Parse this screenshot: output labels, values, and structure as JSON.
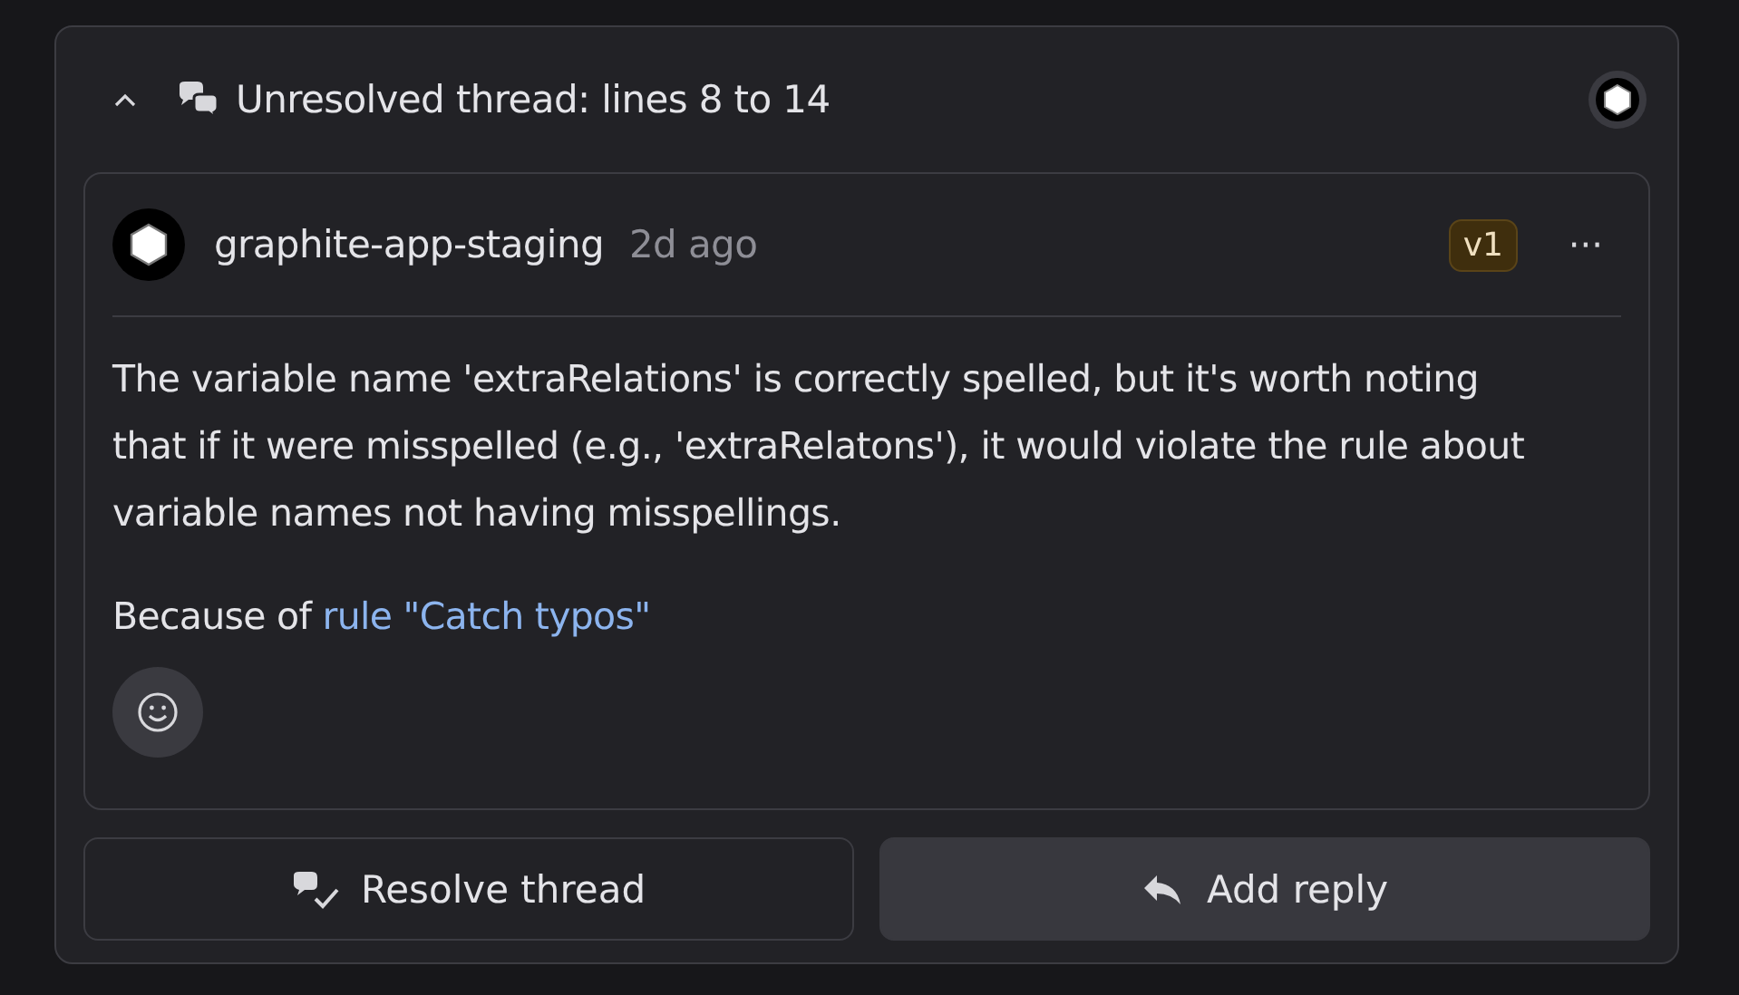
{
  "thread": {
    "expanded": true,
    "title": "Unresolved thread: lines 8 to 14"
  },
  "comment": {
    "author": "graphite-app-staging",
    "time": "2d ago",
    "version": "v1",
    "menu": "···",
    "body": "The variable name 'extraRelations' is correctly spelled, but it's worth noting that if it were misspelled (e.g., 'extraRelatons'), it would violate the rule about variable names not having misspellings.",
    "because_prefix": "Because of",
    "rule_link": "rule \"Catch typos\""
  },
  "buttons": [
    {
      "kind": "resolve",
      "label": "Resolve thread"
    },
    {
      "kind": "reply",
      "label": "Add reply"
    }
  ]
}
